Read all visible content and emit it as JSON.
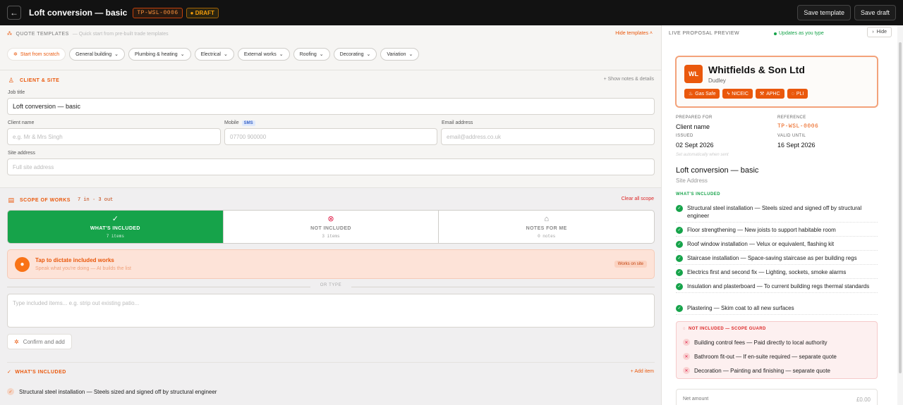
{
  "topbar": {
    "back_icon": "arrow-left-icon",
    "title": "Loft conversion — basic",
    "reference": "TP-WSL-0006",
    "status": "DRAFT",
    "save_template": "Save template",
    "save_draft": "Save draft"
  },
  "templates": {
    "heading": "QUOTE TEMPLATES",
    "subheading": "— Quick start from pre-built trade templates",
    "hide_label": "Hide templates",
    "scratch": "Start from scratch",
    "chips": [
      "General building",
      "Plumbing & heating",
      "Electrical",
      "External works",
      "Roofing",
      "Decorating",
      "Variation"
    ]
  },
  "client": {
    "heading": "CLIENT & SITE",
    "show_notes": "+ Show notes & details",
    "job_title_label": "Job title",
    "job_title_value": "Loft conversion — basic",
    "client_name_label": "Client name",
    "client_name_placeholder": "e.g. Mr & Mrs Singh",
    "mobile_label": "Mobile",
    "mobile_tag": "SMS",
    "mobile_placeholder": "07700 900000",
    "email_label": "Email address",
    "email_placeholder": "email@address.co.uk",
    "site_label": "Site address",
    "site_placeholder": "Full site address"
  },
  "scope": {
    "heading": "SCOPE OF WORKS",
    "count": "7 in · 3 out",
    "clear": "Clear all scope",
    "tabs": [
      {
        "label": "WHAT'S INCLUDED",
        "count": "7 items"
      },
      {
        "label": "NOT INCLUDED",
        "count": "3 items"
      },
      {
        "label": "NOTES FOR ME",
        "count": "0 notes"
      }
    ],
    "dictate_title": "Tap to dictate included works",
    "dictate_sub": "Speak what you're doing — AI builds the list",
    "works_on_site": "Works on site",
    "or_type": "OR TYPE",
    "textarea_placeholder": "Type included items... e.g. strip out existing patio...",
    "confirm": "Confirm and add",
    "included_heading": "WHAT'S INCLUDED",
    "add_item": "+ Add item",
    "first_item": "Structural steel installation — Steels sized and signed off by structural engineer"
  },
  "preview": {
    "heading": "LIVE PROPOSAL PREVIEW",
    "updates": "Updates as you type",
    "hide": "Hide",
    "business": {
      "initials": "WL",
      "name": "Whitfields & Son Ltd",
      "location": "Dudley",
      "badges": [
        "Gas Safe",
        "NICEIC",
        "APHC",
        "PLI"
      ]
    },
    "prepared_for_label": "PREPARED FOR",
    "prepared_for": "Client name",
    "reference_label": "REFERENCE",
    "reference": "TP-WSL-0006",
    "issued_label": "ISSUED",
    "issued": "02 Sept 2026",
    "valid_label": "VALID UNTIL",
    "valid": "16 Sept 2026",
    "auto_note": "Set automatically when sent",
    "job_title": "Loft conversion — basic",
    "site_address": "Site Address",
    "included_heading": "WHAT'S INCLUDED",
    "included": [
      "Structural steel installation — Steels sized and signed off by structural engineer",
      "Floor strengthening — New joists to support habitable room",
      "Roof window installation — Velux or equivalent, flashing kit",
      "Staircase installation — Space-saving staircase as per building regs",
      "Electrics first and second fix — Lighting, sockets, smoke alarms",
      "Insulation and plasterboard — To current building regs thermal standards",
      "Plastering — Skim coat to all new surfaces"
    ],
    "not_included_heading": "NOT INCLUDED — SCOPE GUARD",
    "not_included": [
      "Building control fees — Paid directly to local authority",
      "Bathroom fit-out — If en-suite required — separate quote",
      "Decoration — Painting and finishing — separate quote"
    ],
    "net_label": "Net amount",
    "net_value": "£0.00"
  }
}
